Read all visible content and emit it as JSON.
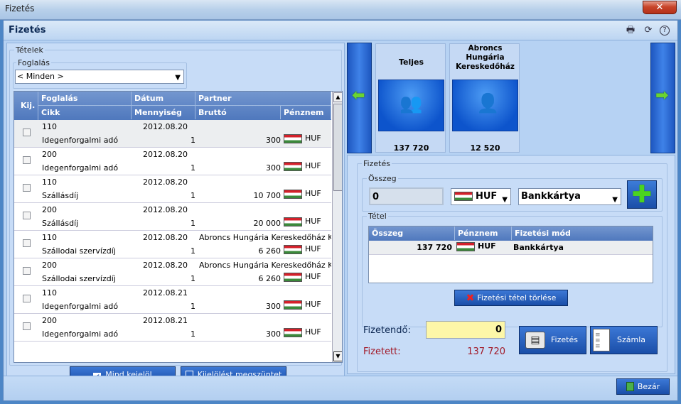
{
  "window": {
    "title": "Fizetés",
    "close_label": "✕"
  },
  "header": {
    "title": "Fizetés"
  },
  "items_group": {
    "legend": "Tételek",
    "filter": {
      "legend": "Foglalás",
      "selected": "< Minden >"
    },
    "columns_top": [
      "Kij.",
      "Foglalás",
      "Dátum",
      "Partner"
    ],
    "columns_bottom": [
      "Cikk",
      "Mennyiség",
      "Bruttó",
      "Pénznem"
    ],
    "rows": [
      {
        "foglalas": "110",
        "datum": "2012.08.20",
        "partner": "",
        "cikk": "Idegenforgalmi adó",
        "mennyiseg": "1",
        "brutto": "300",
        "penznem": "HUF"
      },
      {
        "foglalas": "200",
        "datum": "2012.08.20",
        "partner": "",
        "cikk": "Idegenforgalmi adó",
        "mennyiseg": "1",
        "brutto": "300",
        "penznem": "HUF"
      },
      {
        "foglalas": "110",
        "datum": "2012.08.20",
        "partner": "",
        "cikk": "Szállásdíj",
        "mennyiseg": "1",
        "brutto": "10 700",
        "penznem": "HUF"
      },
      {
        "foglalas": "200",
        "datum": "2012.08.20",
        "partner": "",
        "cikk": "Szállásdíj",
        "mennyiseg": "1",
        "brutto": "20 000",
        "penznem": "HUF"
      },
      {
        "foglalas": "110",
        "datum": "2012.08.20",
        "partner": "Abroncs Hungária Kereskedőház Kf",
        "cikk": "Szállodai szervízdíj",
        "mennyiseg": "1",
        "brutto": "6 260",
        "penznem": "HUF"
      },
      {
        "foglalas": "200",
        "datum": "2012.08.20",
        "partner": "Abroncs Hungária Kereskedőház Kf",
        "cikk": "Szállodai szervízdíj",
        "mennyiseg": "1",
        "brutto": "6 260",
        "penznem": "HUF"
      },
      {
        "foglalas": "110",
        "datum": "2012.08.21",
        "partner": "",
        "cikk": "Idegenforgalmi adó",
        "mennyiseg": "1",
        "brutto": "300",
        "penznem": "HUF"
      },
      {
        "foglalas": "200",
        "datum": "2012.08.21",
        "partner": "",
        "cikk": "Idegenforgalmi adó",
        "mennyiseg": "1",
        "brutto": "300",
        "penznem": "HUF"
      }
    ],
    "select_all_label": "Mind kejelöl",
    "deselect_label": "Kijelölést megszüntet"
  },
  "payers": [
    {
      "name": "Teljes",
      "amount": "137 720"
    },
    {
      "name": "Abroncs Hungária Kereskedőház",
      "amount": "12 520"
    }
  ],
  "payment": {
    "legend": "Fizetés",
    "amount_legend": "Összeg",
    "amount_value": "0",
    "currency": "HUF",
    "method": "Bankkártya",
    "items_legend": "Tétel",
    "table_headers": [
      "Összeg",
      "Pénznem",
      "Fizetési mód"
    ],
    "table_rows": [
      {
        "osszeg": "137 720",
        "penznem": "HUF",
        "mod": "Bankkártya"
      }
    ],
    "delete_label": "Fizetési tétel törlése",
    "due_label": "Fizetendő:",
    "due_value": "0",
    "paid_label": "Fizetett:",
    "paid_value": "137 720",
    "pay_button": "Fizetés",
    "invoice_button": "Számla"
  },
  "footer": {
    "close_button": "Bezár"
  }
}
